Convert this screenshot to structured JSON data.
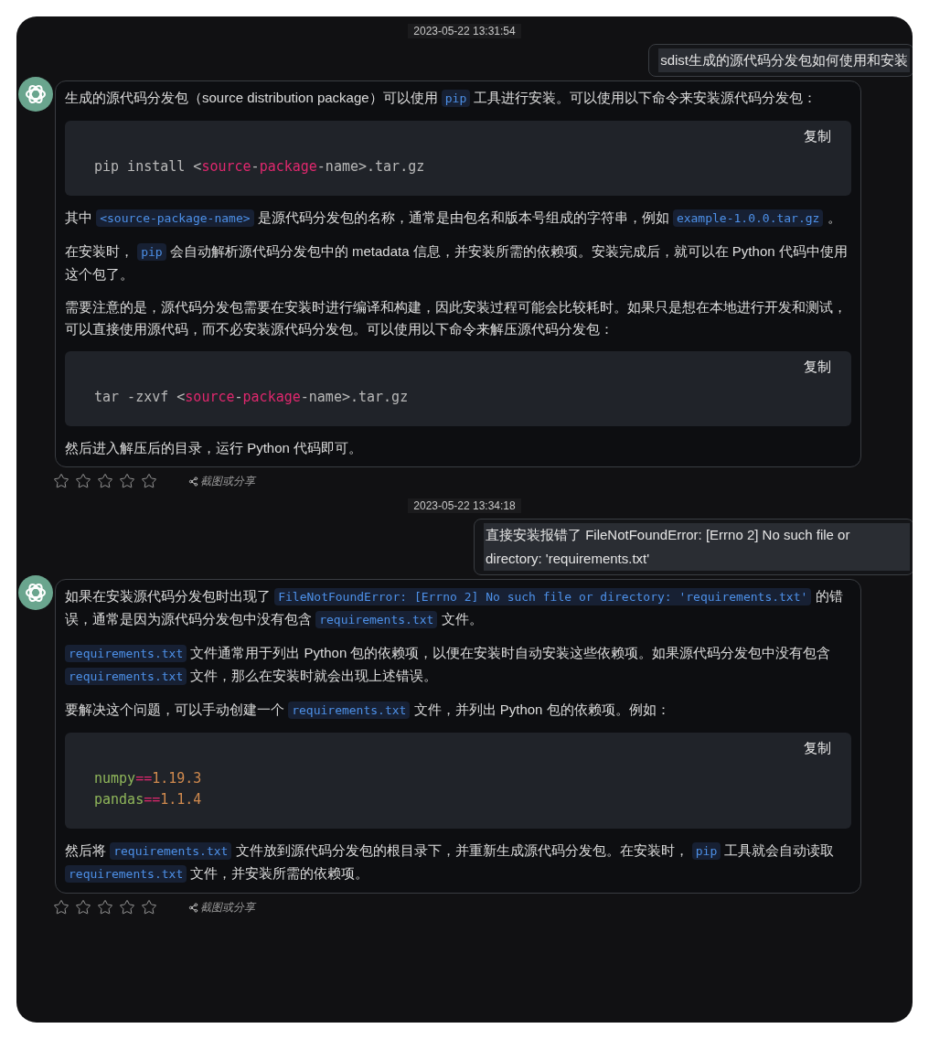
{
  "messages": [
    {
      "kind": "timestamp",
      "text": "2023-05-22 13:31:54"
    },
    {
      "kind": "user",
      "text": "sdist生成的源代码分发包如何使用和安装"
    },
    {
      "kind": "assistant",
      "blocks": [
        {
          "kind": "paragraph",
          "segments": [
            {
              "kind": "text",
              "text": "生成的源代码分发包（source distribution package）可以使用 "
            },
            {
              "kind": "code",
              "text": "pip"
            },
            {
              "kind": "text",
              "text": " 工具进行安装。可以使用以下命令来安装源代码分发包："
            }
          ]
        },
        {
          "kind": "code",
          "copy_label": "复制",
          "lines": [
            [
              {
                "kind": "plain",
                "text": "pip install <"
              },
              {
                "kind": "keyword",
                "text": "source"
              },
              {
                "kind": "plain",
                "text": "-"
              },
              {
                "kind": "keyword",
                "text": "package"
              },
              {
                "kind": "plain",
                "text": "-name>.tar.gz"
              }
            ]
          ]
        },
        {
          "kind": "paragraph",
          "segments": [
            {
              "kind": "text",
              "text": "其中 "
            },
            {
              "kind": "code",
              "text": "<source-package-name>"
            },
            {
              "kind": "text",
              "text": " 是源代码分发包的名称，通常是由包名和版本号组成的字符串，例如 "
            },
            {
              "kind": "code",
              "text": "example-1.0.0.tar.gz"
            },
            {
              "kind": "text",
              "text": " 。"
            }
          ]
        },
        {
          "kind": "paragraph",
          "segments": [
            {
              "kind": "text",
              "text": "在安装时， "
            },
            {
              "kind": "code",
              "text": "pip"
            },
            {
              "kind": "text",
              "text": " 会自动解析源代码分发包中的 metadata 信息，并安装所需的依赖项。安装完成后，就可以在 Python 代码中使用这个包了。"
            }
          ]
        },
        {
          "kind": "paragraph",
          "segments": [
            {
              "kind": "text",
              "text": "需要注意的是，源代码分发包需要在安装时进行编译和构建，因此安装过程可能会比较耗时。如果只是想在本地进行开发和测试，可以直接使用源代码，而不必安装源代码分发包。可以使用以下命令来解压源代码分发包："
            }
          ]
        },
        {
          "kind": "code",
          "copy_label": "复制",
          "lines": [
            [
              {
                "kind": "plain",
                "text": "tar -zxvf <"
              },
              {
                "kind": "keyword",
                "text": "source"
              },
              {
                "kind": "plain",
                "text": "-"
              },
              {
                "kind": "keyword",
                "text": "package"
              },
              {
                "kind": "plain",
                "text": "-name>.tar.gz"
              }
            ]
          ]
        },
        {
          "kind": "paragraph",
          "segments": [
            {
              "kind": "text",
              "text": "然后进入解压后的目录，运行 Python 代码即可。"
            }
          ]
        }
      ],
      "stars": 0,
      "share_label": "截图或分享"
    },
    {
      "kind": "timestamp",
      "text": "2023-05-22 13:34:18"
    },
    {
      "kind": "user",
      "text": "直接安装报错了   FileNotFoundError: [Errno 2] No such file or directory: 'requirements.txt'"
    },
    {
      "kind": "assistant",
      "blocks": [
        {
          "kind": "paragraph",
          "segments": [
            {
              "kind": "text",
              "text": "如果在安装源代码分发包时出现了 "
            },
            {
              "kind": "code",
              "text": "FileNotFoundError: [Errno 2] No such file or directory: 'requirements.txt'"
            },
            {
              "kind": "text",
              "text": " 的错误，通常是因为源代码分发包中没有包含 "
            },
            {
              "kind": "code",
              "text": "requirements.txt"
            },
            {
              "kind": "text",
              "text": " 文件。"
            }
          ]
        },
        {
          "kind": "paragraph",
          "segments": [
            {
              "kind": "code",
              "text": "requirements.txt"
            },
            {
              "kind": "text",
              "text": " 文件通常用于列出 Python 包的依赖项，以便在安装时自动安装这些依赖项。如果源代码分发包中没有包含 "
            },
            {
              "kind": "code",
              "text": "requirements.txt"
            },
            {
              "kind": "text",
              "text": " 文件，那么在安装时就会出现上述错误。"
            }
          ]
        },
        {
          "kind": "paragraph",
          "segments": [
            {
              "kind": "text",
              "text": "要解决这个问题，可以手动创建一个 "
            },
            {
              "kind": "code",
              "text": "requirements.txt"
            },
            {
              "kind": "text",
              "text": " 文件，并列出 Python 包的依赖项。例如："
            }
          ]
        },
        {
          "kind": "code",
          "copy_label": "复制",
          "lines": [
            [
              {
                "kind": "name",
                "text": "numpy"
              },
              {
                "kind": "keyword",
                "text": "=="
              },
              {
                "kind": "number",
                "text": "1.19.3"
              }
            ],
            [
              {
                "kind": "name",
                "text": "pandas"
              },
              {
                "kind": "keyword",
                "text": "=="
              },
              {
                "kind": "number",
                "text": "1.1.4"
              }
            ]
          ]
        },
        {
          "kind": "paragraph",
          "segments": [
            {
              "kind": "text",
              "text": "然后将 "
            },
            {
              "kind": "code",
              "text": "requirements.txt"
            },
            {
              "kind": "text",
              "text": " 文件放到源代码分发包的根目录下，并重新生成源代码分发包。在安装时， "
            },
            {
              "kind": "code",
              "text": "pip"
            },
            {
              "kind": "text",
              "text": " 工具就会自动读取 "
            },
            {
              "kind": "code",
              "text": "requirements.txt"
            },
            {
              "kind": "text",
              "text": " 文件，并安装所需的依赖项。"
            }
          ]
        }
      ],
      "stars": 0,
      "share_label": "截图或分享"
    }
  ]
}
